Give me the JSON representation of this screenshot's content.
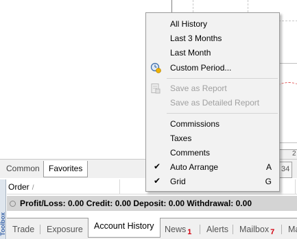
{
  "chart": {
    "x_tick": "2",
    "axis_tab": "34"
  },
  "navigator": {
    "tabs": [
      {
        "label": "Common"
      },
      {
        "label": "Favorites"
      }
    ]
  },
  "side_strip": {
    "label": "Toolbox"
  },
  "table": {
    "columns": [
      {
        "label": "Order"
      }
    ],
    "sort_indicator": "/"
  },
  "summary": {
    "text": "Profit/Loss: 0.00  Credit: 0.00  Deposit: 0.00  Withdrawal: 0.00"
  },
  "terminal_tabs": [
    {
      "label": "Trade"
    },
    {
      "label": "Exposure"
    },
    {
      "label": "Account History",
      "active": true
    },
    {
      "label": "News",
      "badge": "1"
    },
    {
      "label": "Alerts"
    },
    {
      "label": "Mailbox",
      "badge": "7"
    },
    {
      "label": "Ma"
    }
  ],
  "context_menu": {
    "items": [
      {
        "label": "All History"
      },
      {
        "label": "Last 3 Months"
      },
      {
        "label": "Last Month"
      },
      {
        "label": "Custom Period...",
        "icon": "clock-icon"
      },
      {
        "label": "Save as Report",
        "icon": "save-report-icon",
        "disabled": true
      },
      {
        "label": "Save as Detailed Report",
        "disabled": true
      },
      {
        "label": "Commissions"
      },
      {
        "label": "Taxes"
      },
      {
        "label": "Comments"
      },
      {
        "label": "Auto Arrange",
        "checked": true,
        "shortcut": "A"
      },
      {
        "label": "Grid",
        "checked": true,
        "shortcut": "G"
      }
    ],
    "check_glyph": "✔"
  }
}
